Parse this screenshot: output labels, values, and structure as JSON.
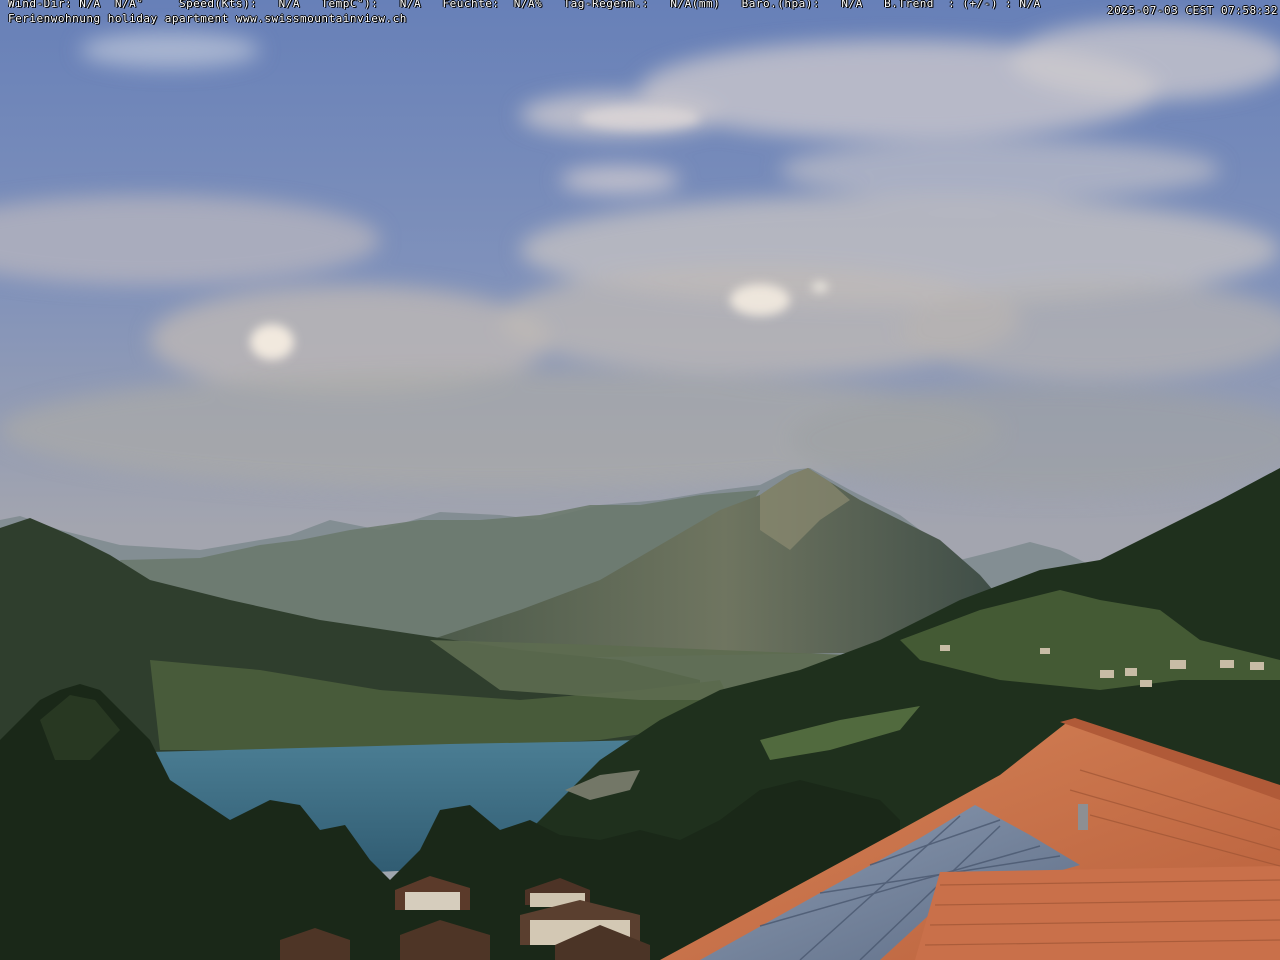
{
  "overlay": {
    "weather_line": "Wind-Dir: N/A  N/A°     Speed(Kts):   N/A   TempC°):   N/A   Feuchte:  N/A%   Tag-Regenm.:   N/A(mm)   Baro.(hpa):   N/A   B.Trend  : (+/-) : N/A",
    "subtitle": "Ferienwohnung holiday apartment www.swissmountainview.ch",
    "timestamp": "2025-07-03 CEST 07:58:32"
  },
  "colors": {
    "sky_top": "#6a82b8",
    "sky_mid": "#9aa6bf",
    "haze": "#a6a9ad",
    "lake": "#3f6e86",
    "forest": "#1e2d1c",
    "roof": "#c9704a",
    "solar": "#7f8ea5"
  }
}
